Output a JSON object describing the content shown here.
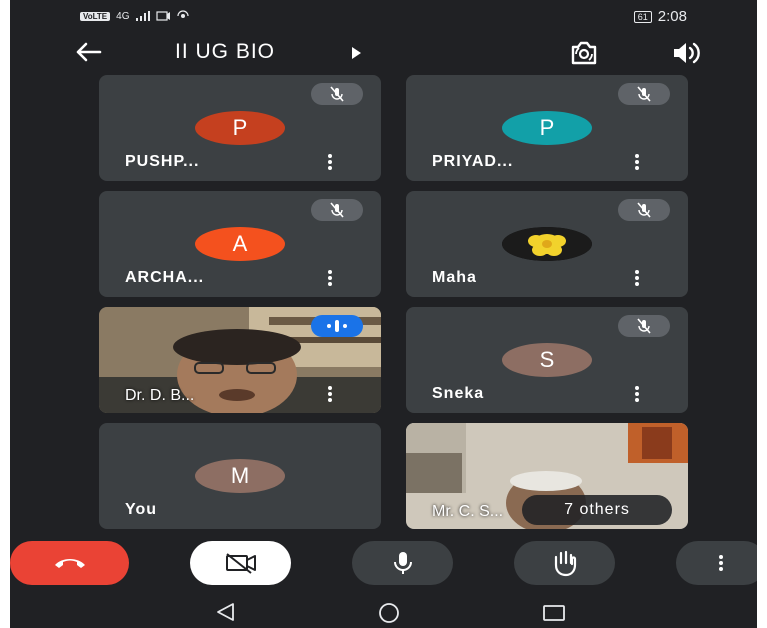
{
  "status_bar": {
    "volte": "VoLTE",
    "network": "4G",
    "battery": "61",
    "time": "2:08"
  },
  "header": {
    "title": "II UG BIO"
  },
  "participants": [
    {
      "name": "PUSHP...",
      "initial": "P",
      "avatar_color": "#c5401f",
      "muted": true
    },
    {
      "name": "PRIYAD...",
      "initial": "P",
      "avatar_color": "#12a0a8",
      "muted": true
    },
    {
      "name": "ARCHA...",
      "initial": "A",
      "avatar_color": "#f4511e",
      "muted": true
    },
    {
      "name": "Maha",
      "initial": "",
      "avatar_color": "",
      "muted": true
    },
    {
      "name": "Dr. D. B...",
      "initial": "",
      "avatar_color": "",
      "muted": false,
      "speaking": true
    },
    {
      "name": "Sneka",
      "initial": "S",
      "avatar_color": "#8d6e63",
      "muted": true
    },
    {
      "name": "You",
      "initial": "M",
      "avatar_color": "#8d6e63",
      "muted": false
    },
    {
      "name": "Mr. C. S...",
      "initial": "",
      "avatar_color": "",
      "muted": false
    }
  ],
  "others_label": "7 others",
  "colors": {
    "background": "#202124",
    "tile": "#3c4043",
    "end_call": "#ea4335",
    "speaking": "#1a73e8"
  }
}
